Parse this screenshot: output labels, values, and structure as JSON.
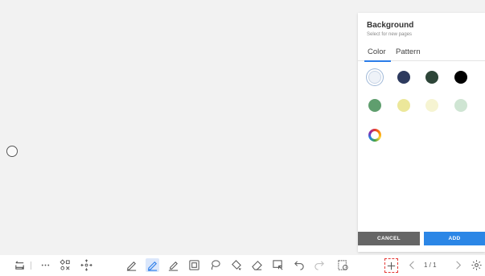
{
  "panel": {
    "title": "Background",
    "subtitle": "Select for new pages",
    "tabs": [
      {
        "label": "Color",
        "active": true
      },
      {
        "label": "Pattern",
        "active": false
      }
    ],
    "swatches": [
      {
        "name": "swatch-light-gray",
        "color": "#eef2f8",
        "selected": true
      },
      {
        "name": "swatch-navy",
        "color": "#2d3a5e"
      },
      {
        "name": "swatch-dark-green",
        "color": "#2d4538"
      },
      {
        "name": "swatch-black",
        "color": "#000000"
      },
      {
        "name": "swatch-green",
        "color": "#5f9e6e"
      },
      {
        "name": "swatch-yellow",
        "color": "#ece79a"
      },
      {
        "name": "swatch-light-yellow",
        "color": "#f6f4d2"
      },
      {
        "name": "swatch-mint",
        "color": "#cfe5d3"
      },
      {
        "name": "swatch-custom-color",
        "color": "conic"
      }
    ],
    "cancel_label": "CANCEL",
    "add_label": "ADD"
  },
  "toolbar": {
    "page_indicator": "1 / 1",
    "accent": "#2b7de9"
  }
}
